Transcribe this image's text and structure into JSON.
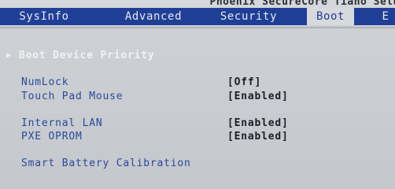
{
  "header": {
    "vendor_title": "Phoenix SecureCore Tiano Setu"
  },
  "tabs": [
    {
      "label": "SysInfo",
      "active": false
    },
    {
      "label": "Advanced",
      "active": false
    },
    {
      "label": "Security",
      "active": false
    },
    {
      "label": "Boot",
      "active": true
    },
    {
      "label": "E",
      "active": false
    }
  ],
  "boot": {
    "boot_device_priority": {
      "arrow": "▶",
      "label": "Boot Device Priority"
    },
    "numlock": {
      "label": "NumLock",
      "value": "[Off]"
    },
    "touch_pad_mouse": {
      "label": "Touch Pad Mouse",
      "value": "[Enabled]"
    },
    "internal_lan": {
      "label": "Internal LAN",
      "value": "[Enabled]"
    },
    "pxe_oprom": {
      "label": "PXE OPROM",
      "value": "[Enabled]"
    },
    "smart_battery_calibration": {
      "label": "Smart Battery Calibration"
    }
  },
  "colors": {
    "tabbar_bg": "#1f3f97",
    "active_tab_bg": "#d8d9dc",
    "item_text": "#274a9a",
    "value_text": "#1b1f2a",
    "highlight_text": "#f2f2f2",
    "screen_bg": "#c8cbd0"
  }
}
